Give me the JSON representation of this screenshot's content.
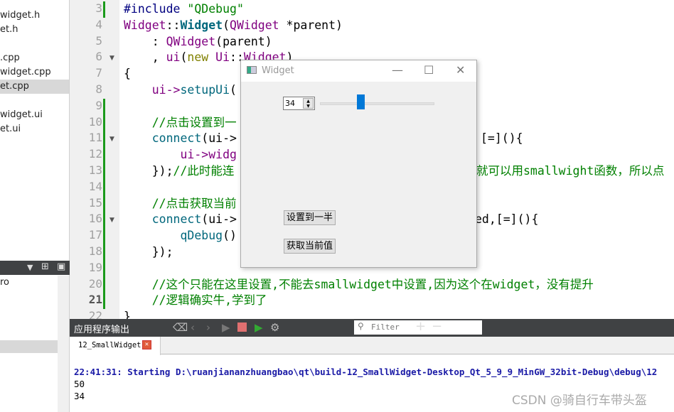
{
  "sidebar": {
    "files": [
      "widget.h",
      "et.h",
      ".cpp",
      "widget.cpp",
      "et.cpp",
      "widget.ui",
      "et.ui"
    ],
    "lower_items": [
      "ro"
    ]
  },
  "editor": {
    "line_numbers": [
      "3",
      "4",
      "5",
      "6",
      "7",
      "8",
      "9",
      "10",
      "11",
      "12",
      "13",
      "14",
      "15",
      "16",
      "17",
      "18",
      "19",
      "20",
      "21",
      "22"
    ],
    "current_line": "21",
    "lines": [
      [
        [
          "#include ",
          "k-pre"
        ],
        [
          "\"QDebug\"",
          "k-str"
        ]
      ],
      [
        [
          "Widget",
          "k-type"
        ],
        [
          "::",
          "k-p"
        ],
        [
          "Widget",
          "k-bold"
        ],
        [
          "(",
          "k-p"
        ],
        [
          "QWidget",
          "k-type"
        ],
        [
          " *parent)",
          "k-p"
        ]
      ],
      [
        [
          "    : ",
          "k-p"
        ],
        [
          "QWidget",
          "k-type"
        ],
        [
          "(parent)",
          "k-p"
        ]
      ],
      [
        [
          "    , ",
          "k-p"
        ],
        [
          "ui",
          "k-type"
        ],
        [
          "(",
          "k-p"
        ],
        [
          "new",
          "k-kw"
        ],
        [
          " ",
          "k-p"
        ],
        [
          "Ui",
          "k-type"
        ],
        [
          "::",
          "k-p"
        ],
        [
          "Widget",
          "k-type"
        ],
        [
          ")",
          "k-p"
        ]
      ],
      [
        [
          "{",
          "k-p"
        ]
      ],
      [
        [
          "    ui->",
          "k-type"
        ],
        [
          "setupUi",
          "k-fn"
        ],
        [
          "(",
          "k-p"
        ]
      ],
      [],
      [
        [
          "    //点击设置到一",
          "k-cm"
        ]
      ],
      [
        [
          "    connect",
          "k-fn"
        ],
        [
          "(ui->",
          "k-p"
        ]
      ],
      [
        [
          "        ui->widg",
          "k-type"
        ]
      ],
      [
        [
          "    });",
          "k-p"
        ],
        [
          "//此时能连",
          "k-cm"
        ]
      ],
      [],
      [
        [
          "    //点击获取当前",
          "k-cm"
        ]
      ],
      [
        [
          "    connect",
          "k-fn"
        ],
        [
          "(ui->",
          "k-p"
        ]
      ],
      [
        [
          "        qDebug",
          "k-fn"
        ],
        [
          "()",
          "k-p"
        ]
      ],
      [
        [
          "    });",
          "k-p"
        ]
      ],
      [],
      [
        [
          "    //这个只能在这里设置,不能去smallwidget中设置,因为这个在widget，没有提升",
          "k-cm"
        ]
      ],
      [
        [
          "    //逻辑确实牛,学到了",
          "k-cm"
        ]
      ],
      [
        [
          "}",
          "k-p"
        ]
      ]
    ],
    "right_fragments": {
      "line11": "[=](){",
      "line13": "就可以用smallwight函数，所以点",
      "line16": "ed,[=](){"
    }
  },
  "output_panel": {
    "title": "应用程序输出",
    "filter_placeholder": "Filter",
    "tab": "12_SmallWidget",
    "lines": [
      "22:41:31: Starting D:\\ruanjiananzhuangbao\\qt\\build-12_SmallWidget-Desktop_Qt_5_9_9_MinGW_32bit-Debug\\debug\\12",
      "50",
      "34"
    ]
  },
  "widget_window": {
    "title": "Widget",
    "spinbox_value": "34",
    "slider_value": 34,
    "slider_max": 99,
    "btn_set_half": "设置到一半",
    "btn_get_value": "获取当前值"
  },
  "watermark": "CSDN @骑自行车带头盔",
  "colors": {
    "accent": "#0078d7",
    "panel_dark": "#404244",
    "comment": "#008000"
  }
}
